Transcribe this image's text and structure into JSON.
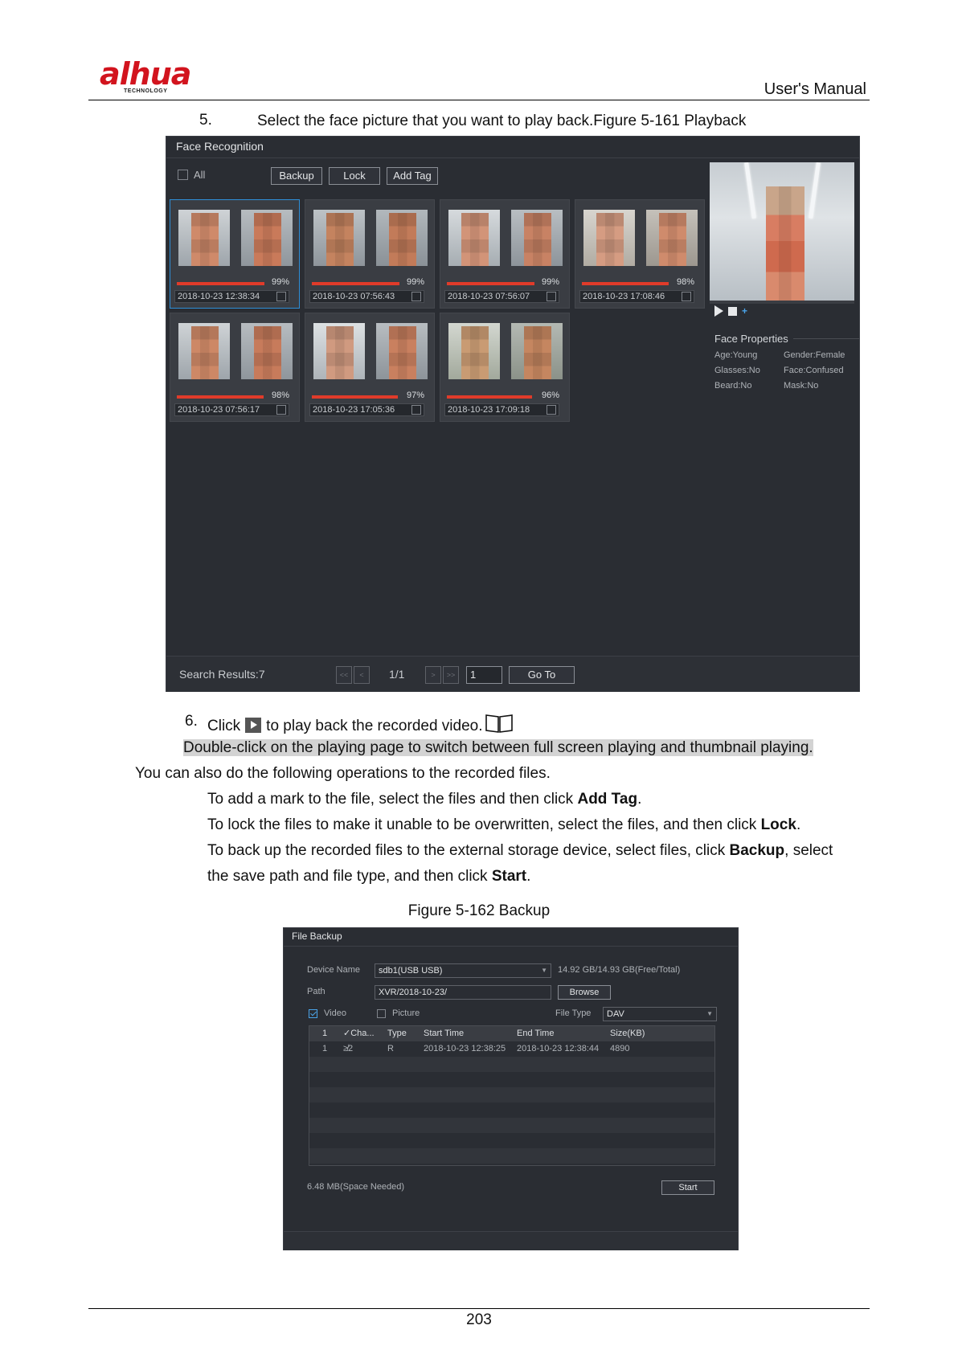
{
  "header": {
    "logo_text": "alhua",
    "logo_sub": "TECHNOLOGY",
    "manual_title": "User's Manual"
  },
  "step5": {
    "num": "5.",
    "text": "Select the face picture that you want to play back.Figure 5-161 Playback"
  },
  "face_recognition": {
    "title": "Face Recognition",
    "all_label": "All",
    "buttons": {
      "backup": "Backup",
      "lock": "Lock",
      "add_tag": "Add Tag"
    },
    "cards": [
      {
        "score": "99%",
        "score_value": 99,
        "time": "2018-10-23 12:38:34",
        "selected": true
      },
      {
        "score": "99%",
        "score_value": 99,
        "time": "2018-10-23 07:56:43",
        "selected": false
      },
      {
        "score": "99%",
        "score_value": 99,
        "time": "2018-10-23 07:56:07",
        "selected": false
      },
      {
        "score": "98%",
        "score_value": 98,
        "time": "2018-10-23 17:08:46",
        "selected": false
      },
      {
        "score": "98%",
        "score_value": 98,
        "time": "2018-10-23 07:56:17",
        "selected": false
      },
      {
        "score": "97%",
        "score_value": 97,
        "time": "2018-10-23 17:05:36",
        "selected": false
      },
      {
        "score": "96%",
        "score_value": 96,
        "time": "2018-10-23 17:09:18",
        "selected": false
      }
    ],
    "properties": {
      "title": "Face Properties",
      "age": "Age:Young",
      "gender": "Gender:Female",
      "glasses": "Glasses:No",
      "face": "Face:Confused",
      "beard": "Beard:No",
      "mask": "Mask:No"
    },
    "footer": {
      "results": "Search Results:7",
      "page": "1/1",
      "page_input": "1",
      "goto_label": "Go To",
      "first": "<<",
      "prev": "<",
      "next": ">",
      "last": ">>"
    }
  },
  "step6": {
    "num": "6.",
    "click": "Click",
    "rest": "to play back the recorded video."
  },
  "note": "Double-click on the playing page to switch between full screen playing and thumbnail playing.",
  "intro": "You can also do the following operations to the recorded files.",
  "bullets": {
    "b1_pre": "To add a mark to the file, select the files and then click ",
    "b1_kw": "Add Tag",
    "b1_post": ".",
    "b2_pre": "To lock the files to make it unable to be overwritten, select the files, and then click ",
    "b2_kw": "Lock",
    "b2_post": ".",
    "b3_pre": "To back up the recorded files to the external storage device, select files, click ",
    "b3_kw": "Backup",
    "b3_post": ", select",
    "b4_pre": "the save path and file type, and then click ",
    "b4_kw": "Start",
    "b4_post": "."
  },
  "figure162_caption": "Figure 5-162 Backup",
  "file_backup": {
    "title": "File Backup",
    "device_label": "Device Name",
    "device_value": "sdb1(USB USB)",
    "capacity": "14.92 GB/14.93 GB(Free/Total)",
    "path_label": "Path",
    "path_value": "XVR/2018-10-23/",
    "browse": "Browse",
    "video_label": "Video",
    "video_checked": true,
    "picture_label": "Picture",
    "picture_checked": false,
    "file_type_label": "File Type",
    "file_type_value": "DAV",
    "columns": [
      "1",
      "✓Cha...",
      "Type",
      "Start Time",
      "End Time",
      "Size(KB)"
    ],
    "rows": [
      [
        "1",
        "≱2",
        "R",
        "2018-10-23 12:38:25",
        "2018-10-23 12:38:44",
        "4890"
      ]
    ],
    "space_needed": "6.48 MB(Space Needed)",
    "start": "Start"
  },
  "page_number": "203"
}
